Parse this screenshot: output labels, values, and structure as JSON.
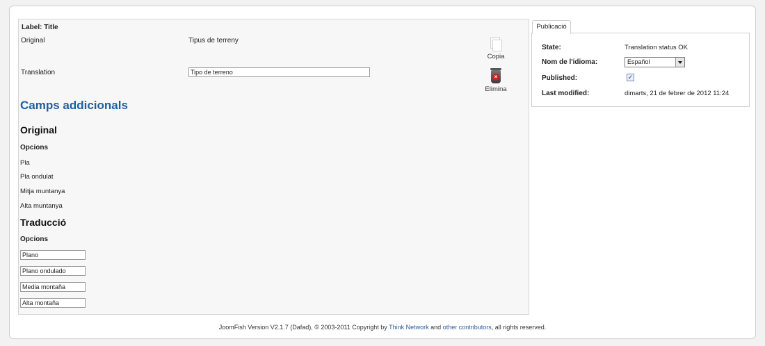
{
  "main": {
    "label_title": "Label: Title",
    "original_label": "Original",
    "original_value": "Tipus de terreny",
    "translation_label": "Translation",
    "translation_value": "Tipo de terreno",
    "copy_label": "Copia",
    "delete_label": "Elimina",
    "extra_heading": "Camps addicionals",
    "original_heading": "Original",
    "original_options_label": "Opcions",
    "original_options": [
      "Pla",
      "Pla ondulat",
      "Mitja muntanya",
      "Alta muntanya"
    ],
    "translation_heading": "Traducció",
    "translation_options_label": "Opcions",
    "translation_options": [
      "Plano",
      "Plano ondulado",
      "Media montaña",
      "Alta montaña"
    ]
  },
  "sidebar": {
    "tab_label": "Publicació",
    "state_label": "State:",
    "state_value": "Translation status OK",
    "language_label": "Nom de l'idioma:",
    "language_value": "Español",
    "published_label": "Published:",
    "published_checked": true,
    "modified_label": "Last modified:",
    "modified_value": "dimarts, 21 de febrer de 2012 11:24"
  },
  "footer": {
    "prefix": "JoomFish Version V2.1.7 (Dafad), © 2003-2011 Copyright by ",
    "link1": "Think Network",
    "middle": " and ",
    "link2": "other contributors",
    "suffix": ", all rights reserved."
  },
  "colors": {
    "heading_blue": "#1f5f9e",
    "link_blue": "#2a5d9a"
  }
}
